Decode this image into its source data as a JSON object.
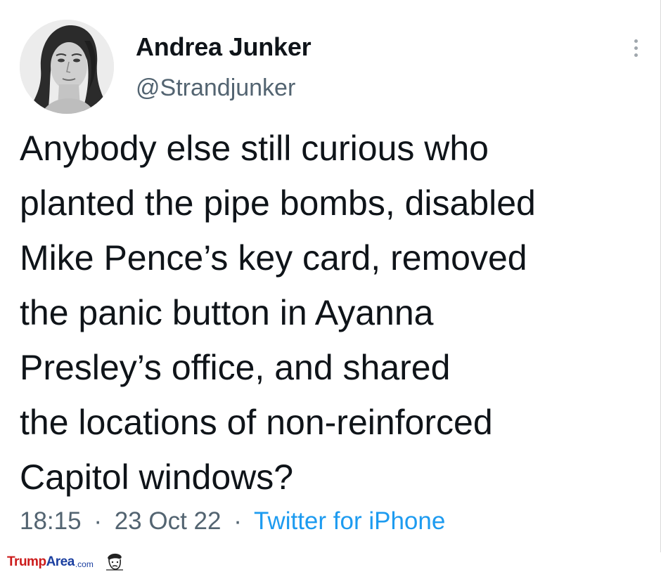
{
  "author": {
    "display_name": "Andrea Junker",
    "handle": "@Strandjunker",
    "avatar_icon": "profile-photo-avatar"
  },
  "menu": {
    "icon": "more-vertical-icon"
  },
  "tweet": {
    "lines": [
      "Anybody else still curious who",
      "planted the pipe bombs, disabled",
      "Mike Pence’s key card, removed",
      "the panic button in Ayanna",
      "Presley’s office, and shared",
      "the locations of non-reinforced",
      "Capitol windows?"
    ]
  },
  "meta": {
    "time": "18:15",
    "separator": "·",
    "date": "23 Oct 22",
    "source": "Twitter for iPhone"
  },
  "watermark": {
    "trump": "Trump",
    "area": "Area",
    "com": ".com",
    "logo_icon": "cartoon-face-logo-icon"
  },
  "colors": {
    "text": "#0f1419",
    "secondary": "#536471",
    "link": "#1d9bf0",
    "watermark_red": "#cc1b1b",
    "watermark_blue": "#1b3fa0"
  }
}
